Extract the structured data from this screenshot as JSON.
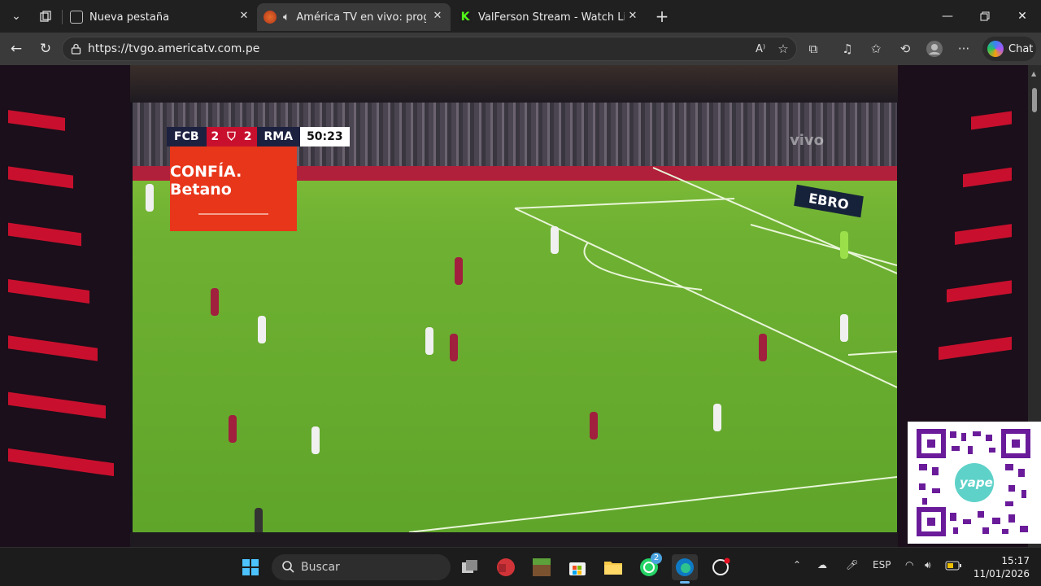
{
  "browser": {
    "tabs": [
      {
        "title": "Nueva pestaña"
      },
      {
        "title": "América TV en vivo: programa"
      },
      {
        "title": "ValFerson Stream - Watch Live on"
      }
    ],
    "url": "https://tvgo.americatv.com.pe",
    "chat_label": "Chat"
  },
  "video": {
    "home_team": "FCB",
    "home_score": "2",
    "away_score": "2",
    "away_team": "RMA",
    "clock": "50:23",
    "ad_text": "CONFÍA. Betano",
    "board_text": "EBRO",
    "watermark": "vivo",
    "qr_label": "yape"
  },
  "taskbar": {
    "search_placeholder": "Buscar",
    "whatsapp_badge": "2",
    "language": "ESP",
    "time": "15:17",
    "date": "11/01/2026"
  },
  "colors": {
    "betano": "#e8361a",
    "accent_red": "#c8102e",
    "pitch": "#6fb132"
  }
}
